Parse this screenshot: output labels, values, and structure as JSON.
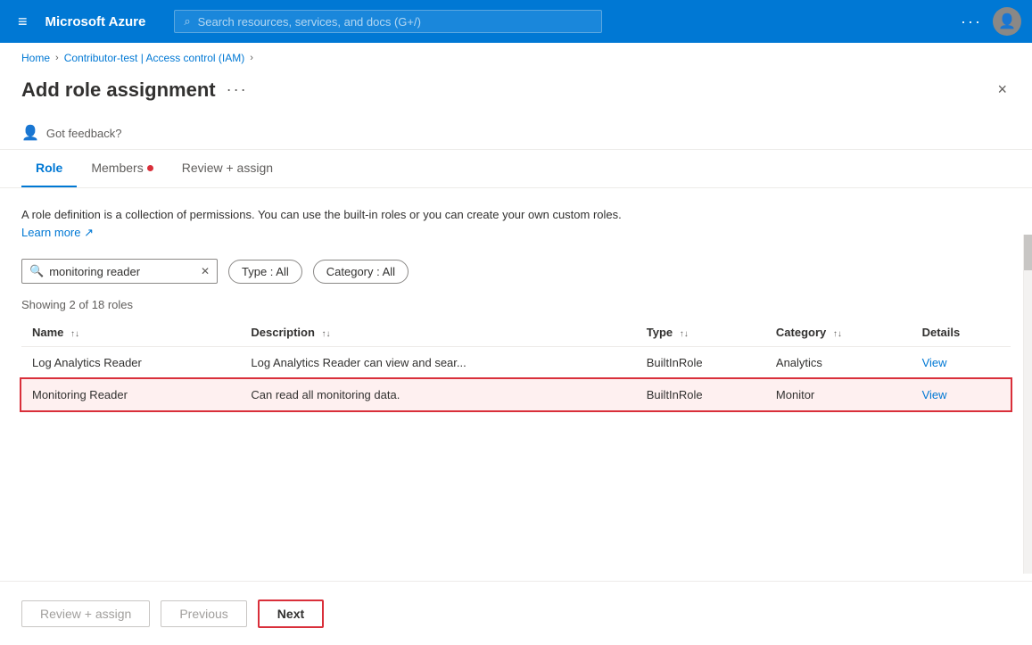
{
  "nav": {
    "title": "Microsoft Azure",
    "search_placeholder": "Search resources, services, and docs (G+/)",
    "hamburger": "≡",
    "dots": "···"
  },
  "breadcrumb": {
    "items": [
      "Home",
      "Contributor-test | Access control (IAM)"
    ]
  },
  "page": {
    "title": "Add role assignment",
    "dots": "···",
    "close": "×"
  },
  "feedback": {
    "text": "Got feedback?"
  },
  "tabs": [
    {
      "label": "Role",
      "active": true,
      "dot": false
    },
    {
      "label": "Members",
      "active": false,
      "dot": true
    },
    {
      "label": "Review + assign",
      "active": false,
      "dot": false
    }
  ],
  "description": {
    "text": "A role definition is a collection of permissions. You can use the built-in roles or you can create your own custom roles.",
    "link_text": "Learn more"
  },
  "filters": {
    "search_value": "monitoring reader",
    "type_pill": "Type : All",
    "category_pill": "Category : All"
  },
  "table": {
    "showing_text": "Showing 2 of 18 roles",
    "columns": [
      "Name",
      "Description",
      "Type",
      "Category",
      "Details"
    ],
    "rows": [
      {
        "name": "Log Analytics Reader",
        "description": "Log Analytics Reader can view and sear...",
        "type": "BuiltInRole",
        "category": "Analytics",
        "details": "View",
        "selected": false
      },
      {
        "name": "Monitoring Reader",
        "description": "Can read all monitoring data.",
        "type": "BuiltInRole",
        "category": "Monitor",
        "details": "View",
        "selected": true
      }
    ]
  },
  "buttons": {
    "review_assign": "Review + assign",
    "previous": "Previous",
    "next": "Next"
  }
}
